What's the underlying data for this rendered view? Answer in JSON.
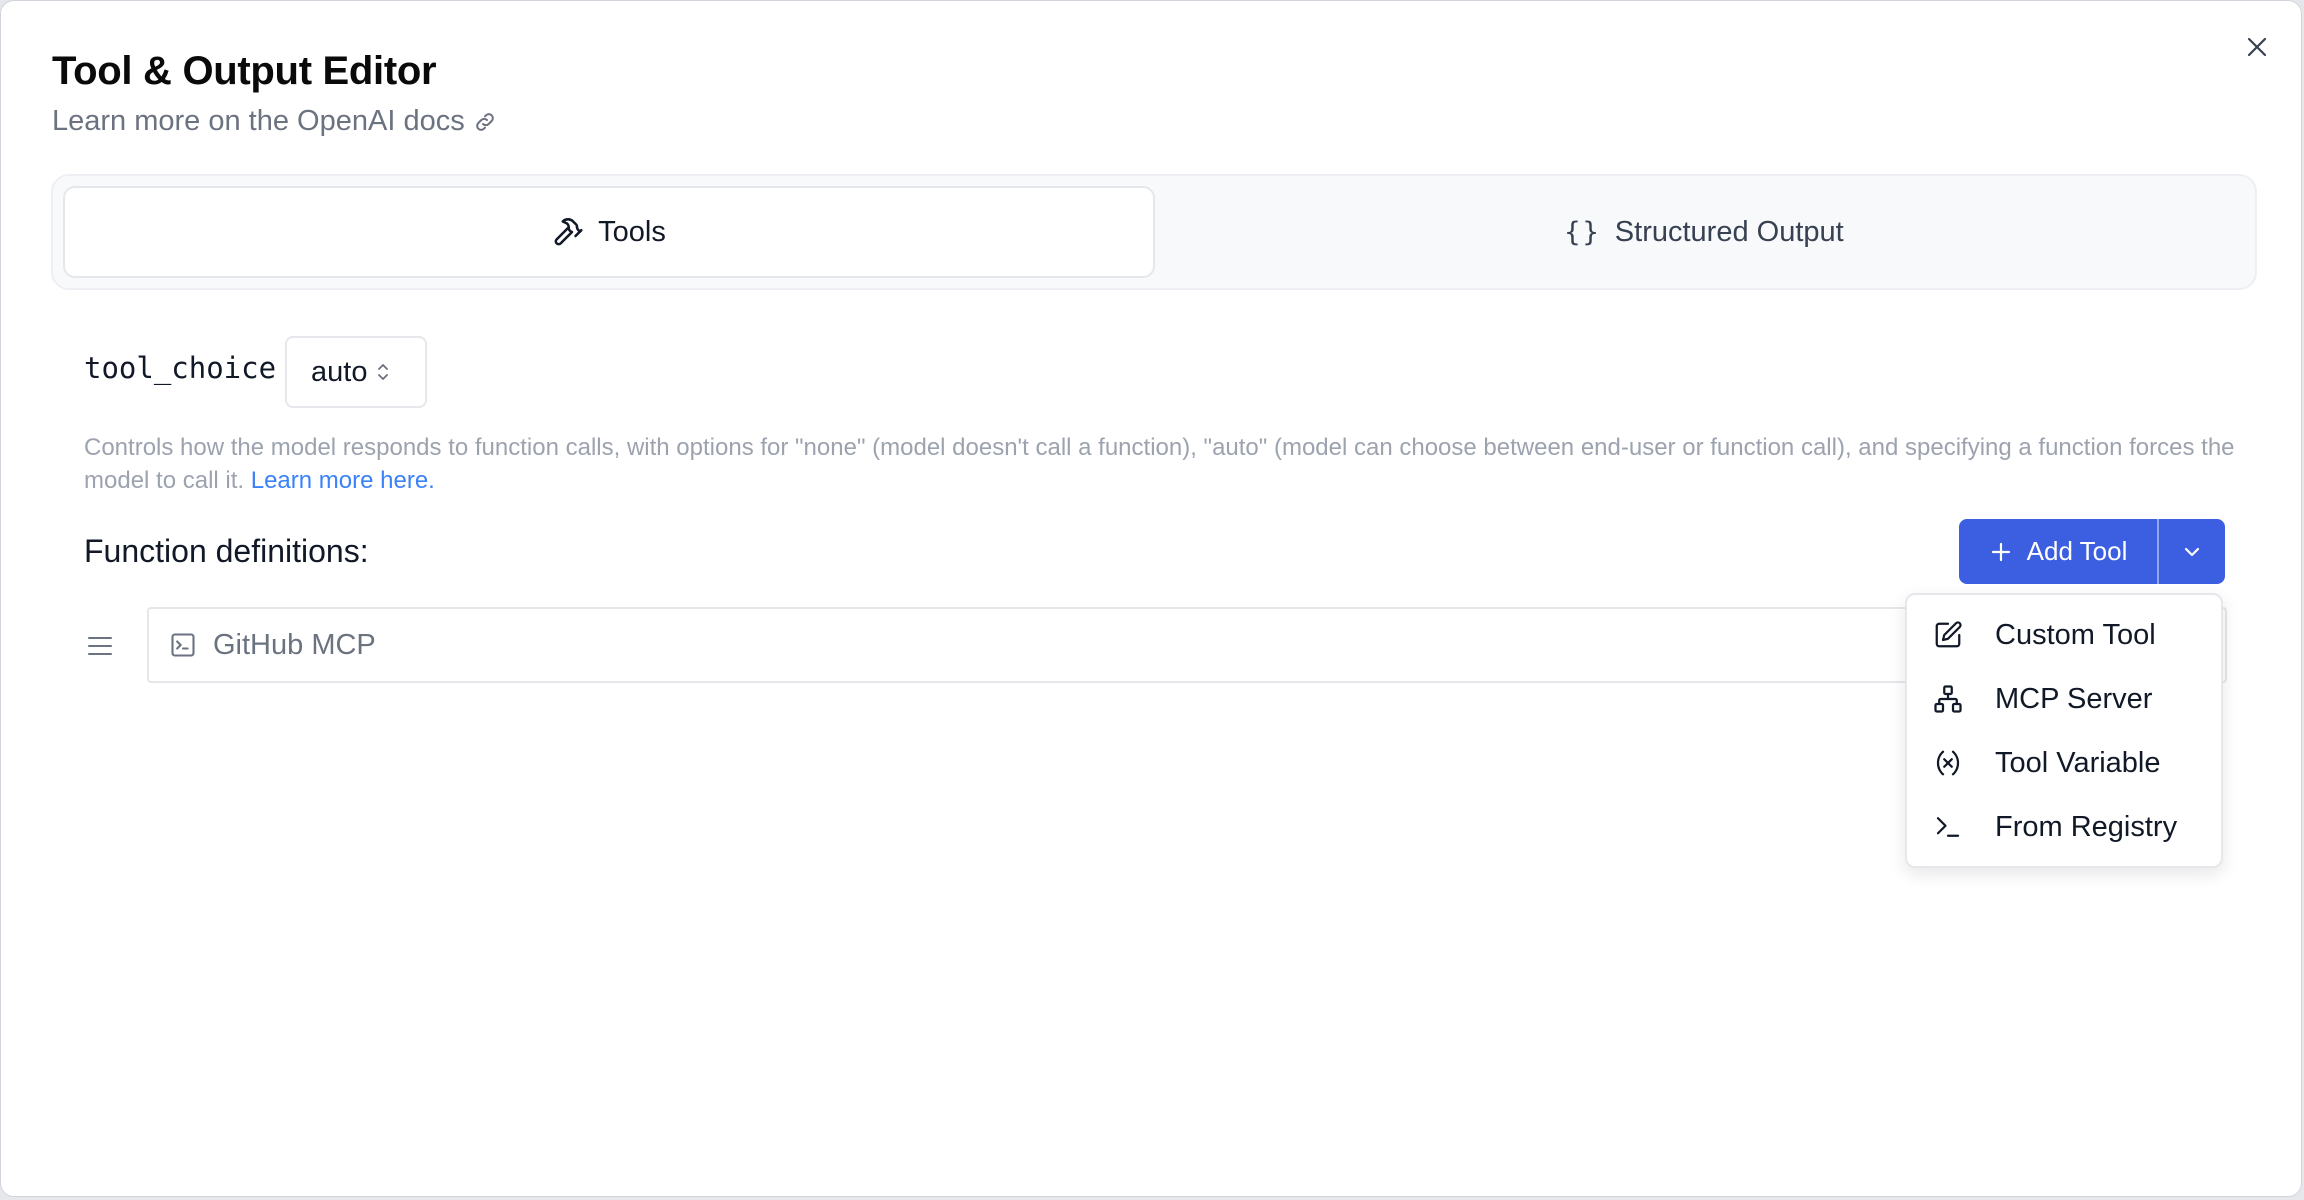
{
  "dialog": {
    "title": "Tool & Output Editor",
    "docs_link": "Learn more on the OpenAI docs"
  },
  "tabs": [
    {
      "label": "Tools",
      "icon": "hammer-icon",
      "active": true
    },
    {
      "label": "Structured Output",
      "icon": "braces-icon",
      "active": false
    }
  ],
  "tool_choice": {
    "label": "tool_choice",
    "value": "auto"
  },
  "help": {
    "text": "Controls how the model responds to function calls, with options for \"none\" (model doesn't call a function), \"auto\" (model can choose between end-user or function call), and specifying a function forces the model to call it. ",
    "link": "Learn more here."
  },
  "function_definitions": {
    "heading": "Function definitions:",
    "add_tool_label": "Add Tool",
    "items": [
      {
        "label": "GitHub MCP",
        "icon": "terminal-icon"
      }
    ]
  },
  "add_menu": {
    "items": [
      {
        "label": "Custom Tool",
        "icon": "edit-icon"
      },
      {
        "label": "MCP Server",
        "icon": "network-icon"
      },
      {
        "label": "Tool Variable",
        "icon": "variable-icon"
      },
      {
        "label": "From Registry",
        "icon": "terminal-prompt-icon"
      }
    ]
  },
  "colors": {
    "primary": "#3b5fe0",
    "link": "#3b82f6",
    "muted_text": "#9ca3af"
  }
}
